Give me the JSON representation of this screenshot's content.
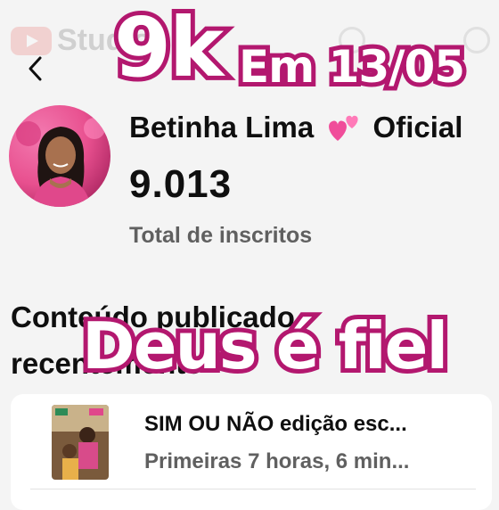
{
  "app": {
    "logo_text": "Studio"
  },
  "header": {
    "back_icon": "chevron-left-icon"
  },
  "channel": {
    "name_part1": "Betinha Lima",
    "emoji": "two-hearts-icon",
    "name_part2": "Oficial",
    "subscriber_count": "9.013",
    "subscriber_label": "Total de inscritos"
  },
  "section": {
    "title": "Conteúdo publicado recentemente"
  },
  "recent_video": {
    "title": "SIM OU NÃO  edição esc...",
    "meta": "Primeiras 7 horas, 6 min..."
  },
  "overlay": {
    "big_text": "9k",
    "date_text": "Em 13/05",
    "caption": "Deus é fiel"
  },
  "colors": {
    "overlay_outline": "#b3186f",
    "overlay_fill": "#ffffff",
    "avatar_bg": "#e8508f"
  }
}
